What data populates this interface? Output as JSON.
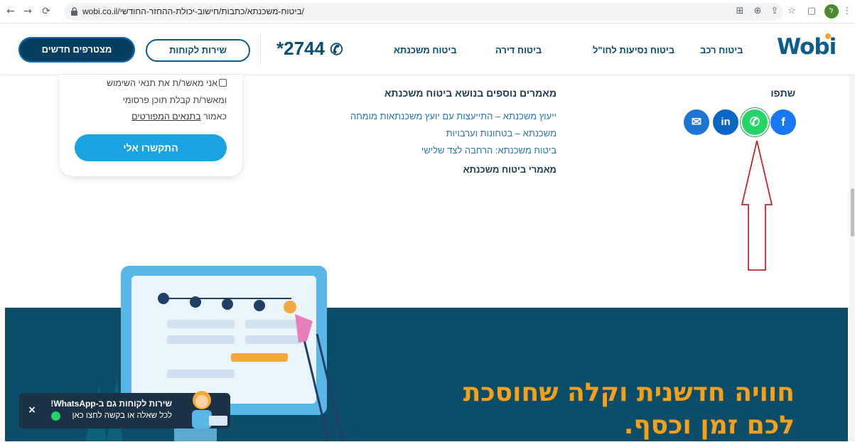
{
  "browser": {
    "url": "wobi.co.il/ביטוח-משכנתא/כתבות/חישוב-יכולת-ההחזר-החודשי/",
    "profile_initial": "ל"
  },
  "header": {
    "logo": "Wobi",
    "menu": [
      "ביטוח רכב",
      "ביטוח נסיעות לחו\"ל",
      "ביטוח דירה",
      "ביטוח משכנתא"
    ],
    "phone": "*2744",
    "customer_service": "שירות לקוחות",
    "join": "מצטרפים חדשים"
  },
  "form": {
    "consent_line1": "אני מאשר/ת את תנאי השימוש",
    "consent_line2": "ומאשר/ת קבלת תוכן פרסומי",
    "consent_line3_prefix": "כאמור",
    "consent_link": "בתנאים המפורטים",
    "call_button": "התקשרו אלי"
  },
  "articles": {
    "title": "מאמרים נוספים בנושא ביטוח משכנתא",
    "links": [
      "ייעוץ משכנתא – התייעצות עם יועץ משכנתאות מומחה",
      "משכנתא – בטחונות וערבויות",
      "ביטוח משכנתא: הרחבה לצד שלישי"
    ],
    "more": "מאמרי ביטוח משכנתא"
  },
  "share": {
    "title": "שתפו",
    "buttons": [
      {
        "name": "facebook",
        "glyph": "f",
        "color": "#1877f2"
      },
      {
        "name": "whatsapp",
        "glyph": "✆",
        "color": "#25d366"
      },
      {
        "name": "linkedin",
        "glyph": "in",
        "color": "#0a66c2"
      },
      {
        "name": "email",
        "glyph": "✉",
        "color": "#1f75d1"
      }
    ]
  },
  "hero": {
    "line1": "חוויה חדשנית וקלה שחוסכת",
    "line2": "לכם זמן וכסף."
  },
  "whatsapp_toast": {
    "line1": "שירות לקוחות גם ב-WhatsApp!",
    "line2": "לכל שאלה או בקשה לחצו כאן",
    "close": "×"
  },
  "colors": {
    "brand": "#0a5d8c",
    "accent": "#f6a01a",
    "hero_bg": "#0c4d6a",
    "call_button": "#1aa4e3"
  }
}
